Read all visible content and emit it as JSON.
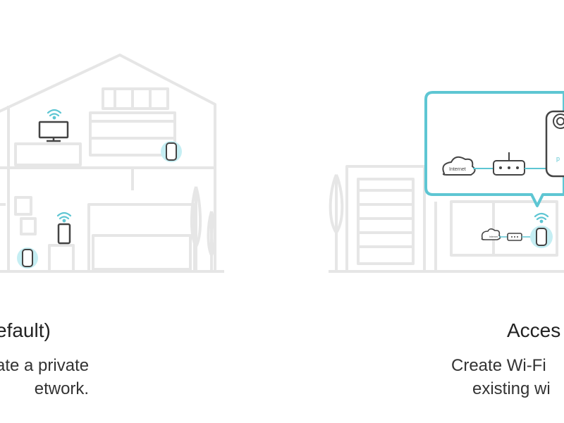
{
  "router_mode": {
    "title": "efault)",
    "description_line1": "ate a private",
    "description_line2": "etwork.",
    "selected": false
  },
  "access_point_mode": {
    "title": "Acces",
    "description_line1": "Create Wi-Fi",
    "description_line2": "existing wi",
    "callout_label": "Internet",
    "mini_label": "Internet",
    "selected": true
  },
  "colors": {
    "accent": "#5ec6d3",
    "line_art": "#e6e6e6",
    "text_dark": "#222222"
  },
  "icons": [
    "house-illustration",
    "wifi-icon",
    "tv-icon",
    "phone-icon",
    "deco-unit-icon",
    "cloud-icon",
    "modem-icon",
    "callout-bubble"
  ]
}
